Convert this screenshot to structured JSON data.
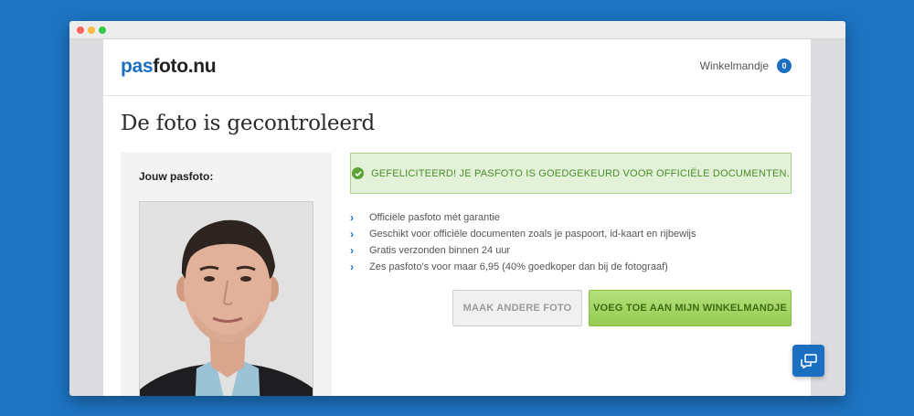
{
  "window": {
    "controls": [
      "close",
      "minimize",
      "maximize"
    ]
  },
  "header": {
    "logo_part1": "pas",
    "logo_part2": "foto.nu",
    "cart_label": "Winkelmandje",
    "cart_count": "0"
  },
  "main": {
    "title": "De foto is gecontroleerd",
    "photo_label": "Jouw pasfoto:",
    "success_message": "GEFELICITEERD! JE PASFOTO IS GOEDGEKEURD VOOR OFFICIËLE DOCUMENTEN.",
    "features": [
      "Officiële pasfoto mét garantie",
      "Geschikt voor officiële documenten zoals je paspoort, id-kaart en rijbewijs",
      "Gratis verzonden binnen 24 uur",
      "Zes pasfoto's voor maar 6,95 (40% goedkoper dan bij de fotograaf)"
    ],
    "secondary_button": "MAAK ANDERE FOTO",
    "primary_button": "VOEG TOE AAN MIJN WINKELMANDJE"
  },
  "colors": {
    "background": "#1d74c2",
    "brand_blue": "#1b6fc0",
    "success_green": "#4b8d2a",
    "primary_button_green": "#95cc53"
  },
  "icons": {
    "success": "check-circle-icon",
    "feature_bullet": "chevron-right-icon",
    "chat": "chat-bubbles-icon"
  }
}
